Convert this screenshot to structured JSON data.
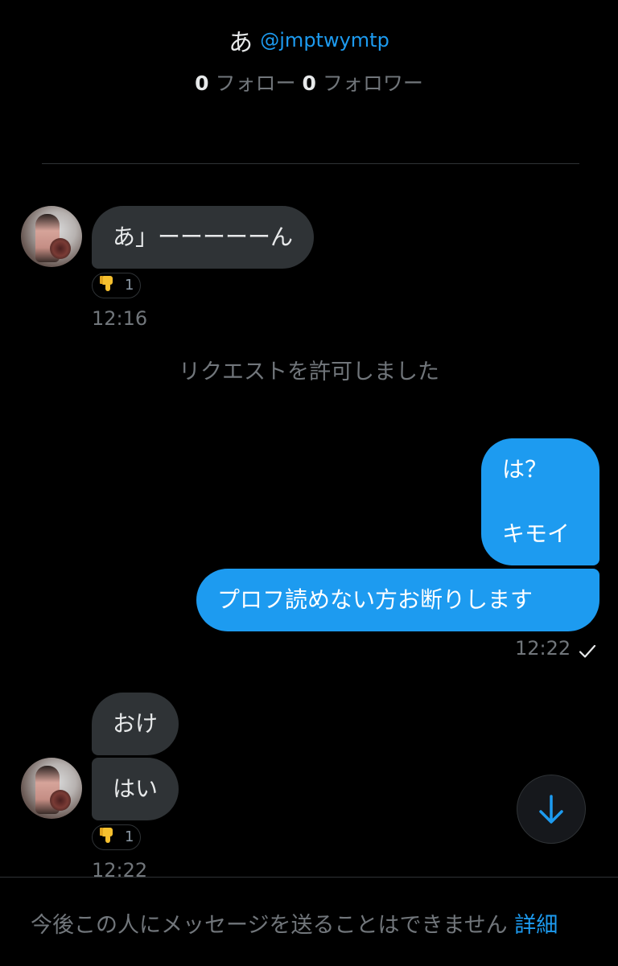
{
  "header": {
    "display_name": "あ",
    "handle": "@jmptwymtp",
    "following_count": "0",
    "following_label": "フォロー",
    "followers_count": "0",
    "followers_label": "フォロワー"
  },
  "messages": {
    "in1": {
      "text": "あ」ーーーーーん",
      "reaction_emoji": "thumbs-down-emoji",
      "reaction_count": "1",
      "time": "12:16"
    },
    "system": "リクエストを許可しました",
    "out1": {
      "line1": "は？",
      "line2": "キモイ"
    },
    "out2": {
      "text": "プロフ読めない方お断りします",
      "time": "12:22",
      "status_icon": "checkmark-icon"
    },
    "in2": {
      "text": "おけ"
    },
    "in3": {
      "text": "はい",
      "reaction_emoji": "thumbs-down-emoji",
      "reaction_count": "1",
      "time": "12:22"
    }
  },
  "scroll_button": {
    "icon": "arrow-down-icon"
  },
  "footer": {
    "text": "今後この人にメッセージを送ることはできません",
    "link": "詳細"
  },
  "colors": {
    "background": "#000000",
    "accent": "#1d9bf0",
    "incoming_bubble": "#2f3336",
    "muted_text": "#71767b"
  }
}
